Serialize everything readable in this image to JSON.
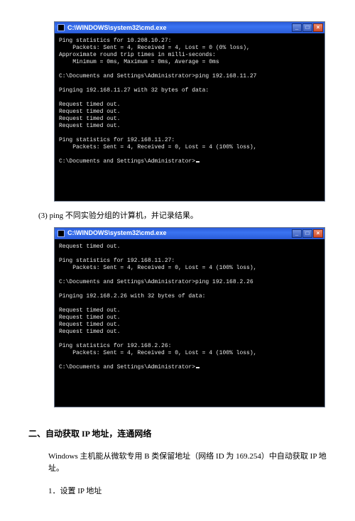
{
  "cmd1": {
    "title": "C:\\WINDOWS\\system32\\cmd.exe",
    "btnMin": "_",
    "btnMax": "□",
    "btnClose": "×",
    "body": "Ping statistics for 10.208.10.27:\n    Packets: Sent = 4, Received = 4, Lost = 0 (0% loss),\nApproximate round trip times in milli-seconds:\n    Minimum = 0ms, Maximum = 0ms, Average = 0ms\n\nC:\\Documents and Settings\\Administrator>ping 192.168.11.27\n\nPinging 192.168.11.27 with 32 bytes of data:\n\nRequest timed out.\nRequest timed out.\nRequest timed out.\nRequest timed out.\n\nPing statistics for 192.168.11.27:\n    Packets: Sent = 4, Received = 0, Lost = 4 (100% loss),\n\nC:\\Documents and Settings\\Administrator>"
  },
  "caption1": "(3) ping 不同实验分组的计算机，并记录结果。",
  "cmd2": {
    "title": "C:\\WINDOWS\\system32\\cmd.exe",
    "btnMin": "_",
    "btnMax": "□",
    "btnClose": "×",
    "body": "Request timed out.\n\nPing statistics for 192.168.11.27:\n    Packets: Sent = 4, Received = 0, Lost = 4 (100% loss),\n\nC:\\Documents and Settings\\Administrator>ping 192.168.2.26\n\nPinging 192.168.2.26 with 32 bytes of data:\n\nRequest timed out.\nRequest timed out.\nRequest timed out.\nRequest timed out.\n\nPing statistics for 192.168.2.26:\n    Packets: Sent = 4, Received = 0, Lost = 4 (100% loss),\n\nC:\\Documents and Settings\\Administrator>"
  },
  "sectionHeading": "二、自动获取 IP 地址，连通网络",
  "paragraph1": "Windows 主机能从微软专用 B 类保留地址（网络 ID 为 169.254）中自动获取 IP 地址。",
  "step1": "1．设置 IP 地址"
}
